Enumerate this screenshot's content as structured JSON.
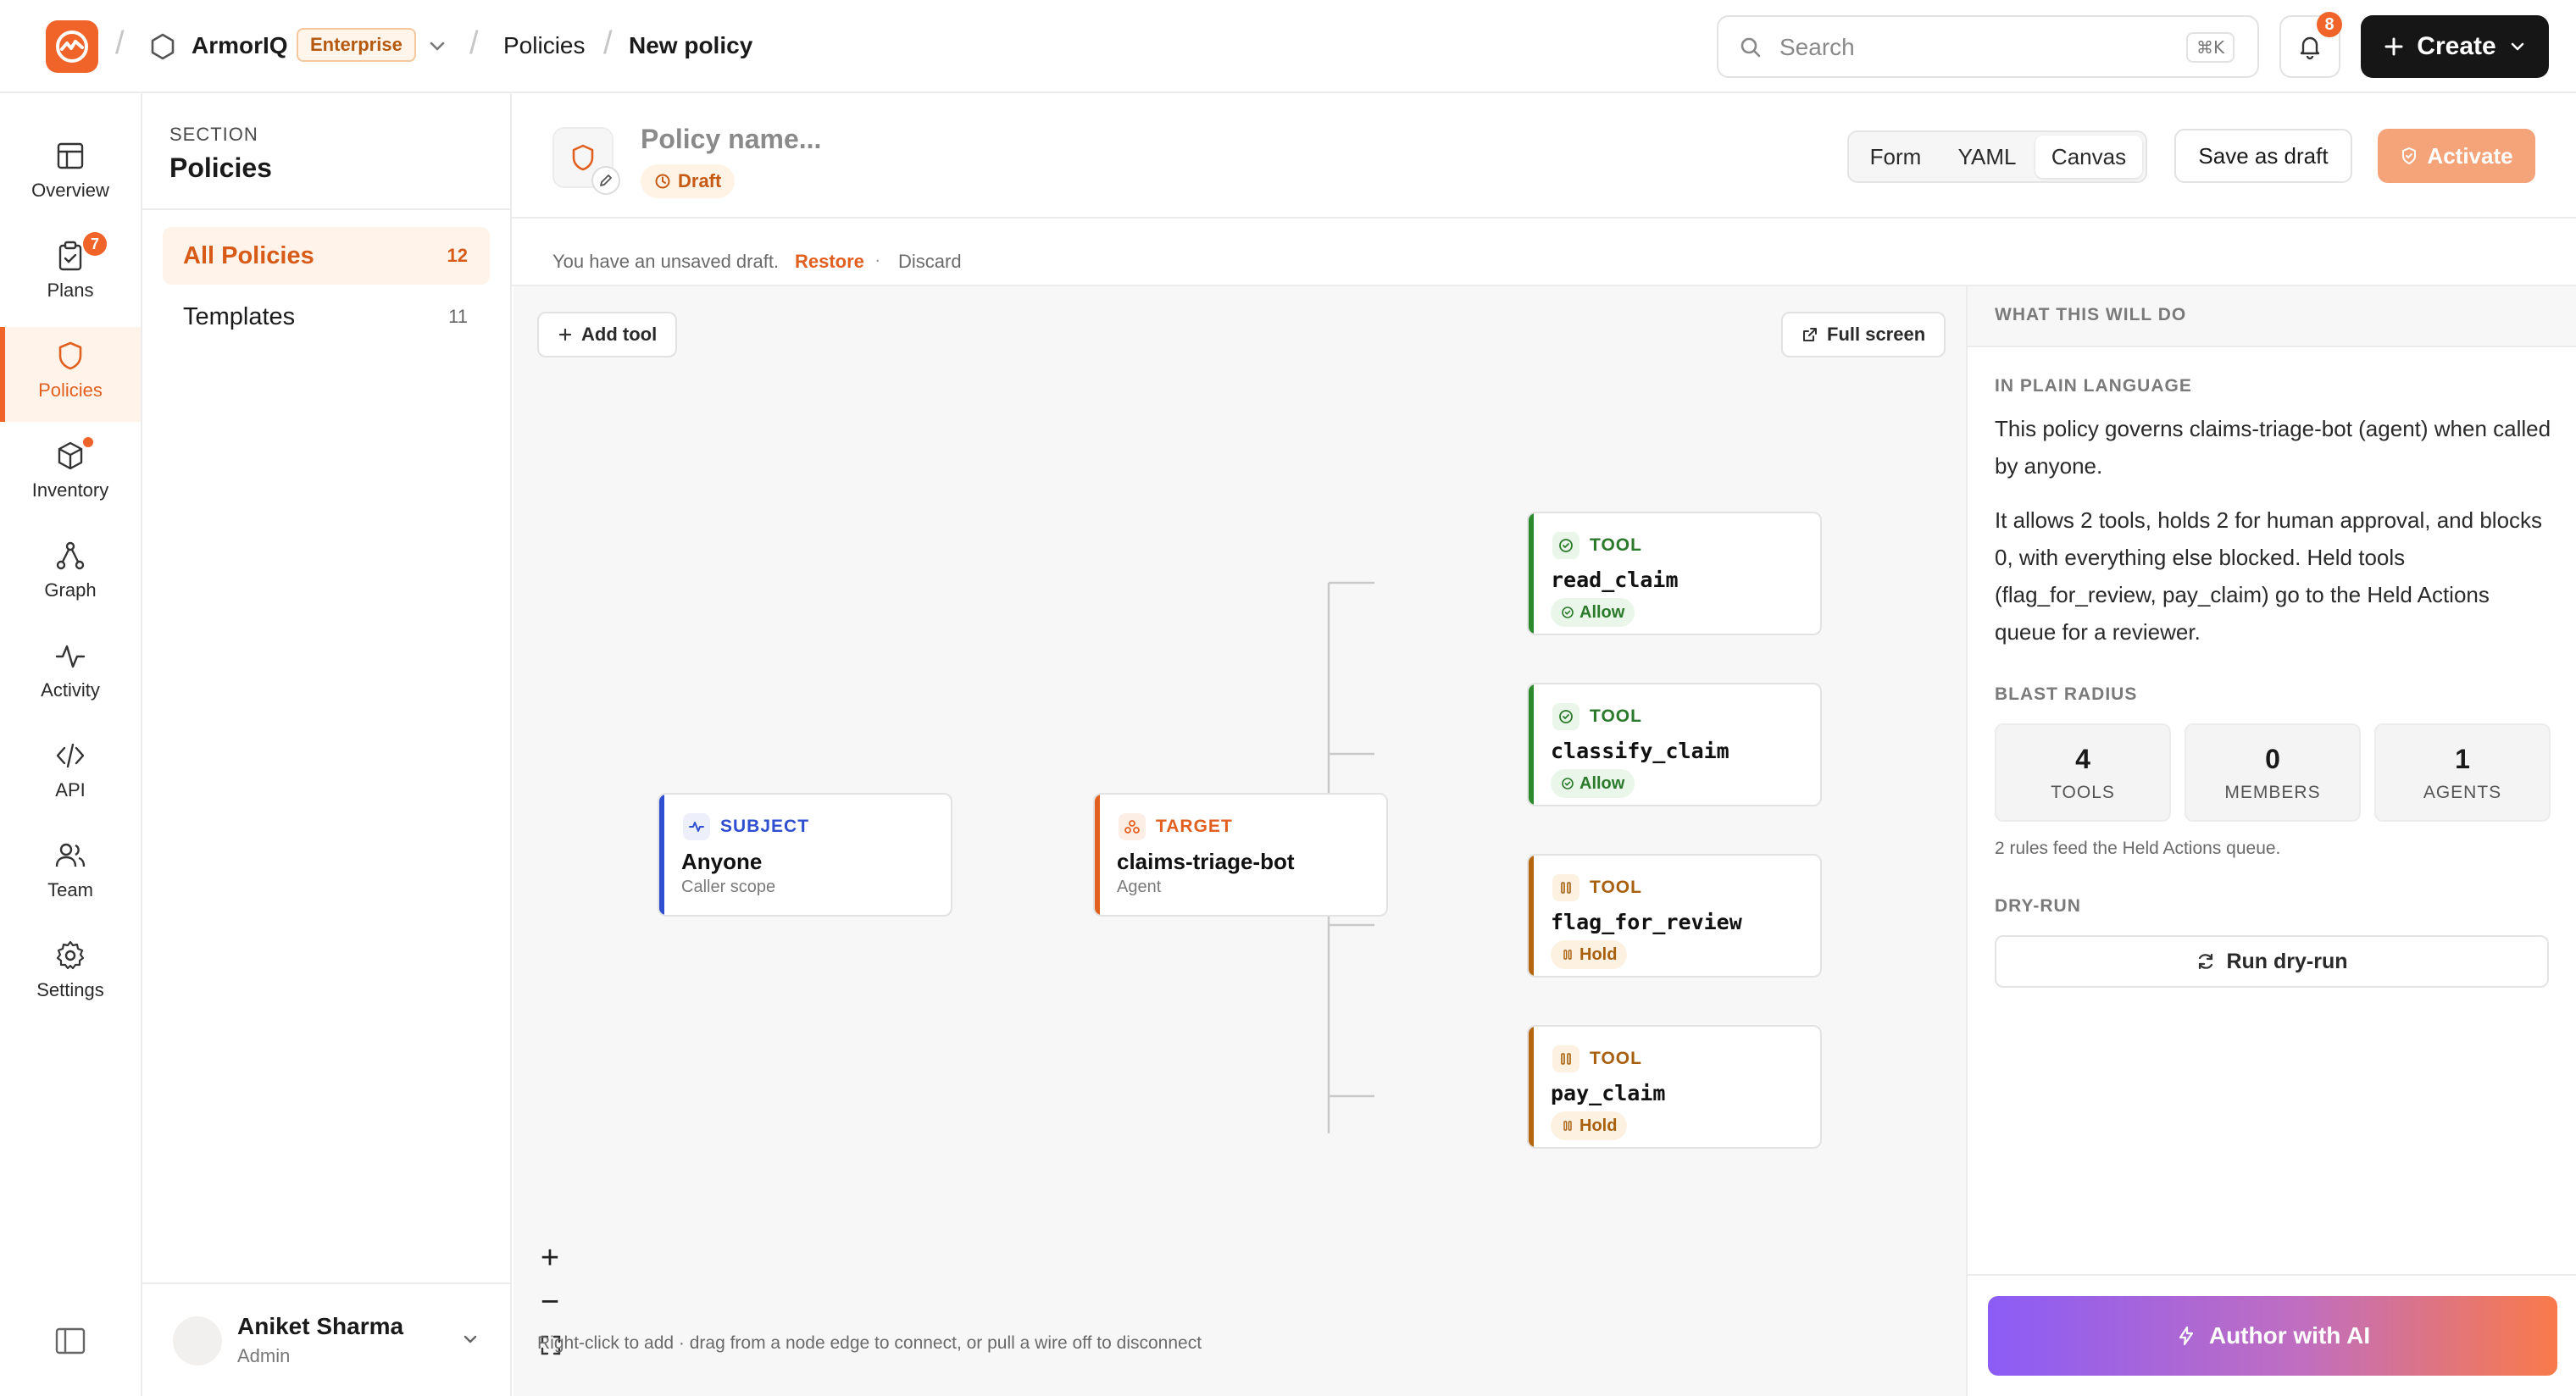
{
  "topbar": {
    "org_name": "ArmorIQ",
    "plan_badge": "Enterprise",
    "crumb_policies": "Policies",
    "crumb_current": "New policy",
    "search_placeholder": "Search",
    "search_shortcut": "⌘K",
    "notification_count": "8",
    "create_label": "Create"
  },
  "rail": {
    "items": [
      {
        "label": "Overview",
        "icon": "layout-icon"
      },
      {
        "label": "Plans",
        "icon": "clipboard-check-icon",
        "badge": "7"
      },
      {
        "label": "Policies",
        "icon": "shield-icon",
        "active": true
      },
      {
        "label": "Inventory",
        "icon": "box-icon",
        "dot": true
      },
      {
        "label": "Graph",
        "icon": "graph-icon"
      },
      {
        "label": "Activity",
        "icon": "activity-icon"
      },
      {
        "label": "API",
        "icon": "code-icon"
      },
      {
        "label": "Team",
        "icon": "users-icon"
      },
      {
        "label": "Settings",
        "icon": "gear-icon"
      }
    ]
  },
  "section": {
    "kicker": "SECTION",
    "title": "Policies",
    "items": [
      {
        "label": "All Policies",
        "count": "12",
        "active": true
      },
      {
        "label": "Templates",
        "count": "11"
      }
    ],
    "user": {
      "name": "Aniket Sharma",
      "role": "Admin"
    }
  },
  "header": {
    "policy_name_placeholder": "Policy name...",
    "status": "Draft",
    "view_tabs": [
      "Form",
      "YAML",
      "Canvas"
    ],
    "active_view": "Canvas",
    "save_draft_label": "Save as draft",
    "activate_label": "Activate"
  },
  "draft_bar": {
    "message": "You have an unsaved draft.",
    "restore": "Restore",
    "separator": "·",
    "discard": "Discard"
  },
  "canvas": {
    "add_tool_label": "Add tool",
    "fullscreen_label": "Full screen",
    "subject": {
      "kicker": "SUBJECT",
      "title": "Anyone",
      "sub": "Caller scope"
    },
    "target": {
      "kicker": "TARGET",
      "title": "claims-triage-bot",
      "sub": "Agent"
    },
    "tools": [
      {
        "kicker": "TOOL",
        "name": "read_claim",
        "decision": "Allow"
      },
      {
        "kicker": "TOOL",
        "name": "classify_claim",
        "decision": "Allow"
      },
      {
        "kicker": "TOOL",
        "name": "flag_for_review",
        "decision": "Hold"
      },
      {
        "kicker": "TOOL",
        "name": "pay_claim",
        "decision": "Hold"
      }
    ],
    "zoom_in": "+",
    "zoom_out": "−",
    "hint": "Right-click to add · drag from a node edge to connect, or pull a wire off to disconnect"
  },
  "summary": {
    "header": "WHAT THIS WILL DO",
    "plain_kicker": "IN PLAIN LANGUAGE",
    "para1": "This policy governs claims-triage-bot (agent) when called by anyone.",
    "para2": "It allows 2 tools, holds 2 for human approval, and blocks 0, with everything else blocked. Held tools (flag_for_review, pay_claim) go to the Held Actions queue for a reviewer.",
    "blast_kicker": "BLAST RADIUS",
    "stats": [
      {
        "value": "4",
        "label": "TOOLS"
      },
      {
        "value": "0",
        "label": "MEMBERS"
      },
      {
        "value": "1",
        "label": "AGENTS"
      }
    ],
    "note": "2 rules feed the Held Actions queue.",
    "dry_kicker": "DRY-RUN",
    "dry_label": "Run dry-run",
    "ai_label": "Author with AI"
  },
  "colors": {
    "accent": "#f0642a",
    "subject": "#2f4fd0",
    "target": "#e2601f",
    "allow": "#2b8a2b",
    "hold": "#b4650e"
  }
}
